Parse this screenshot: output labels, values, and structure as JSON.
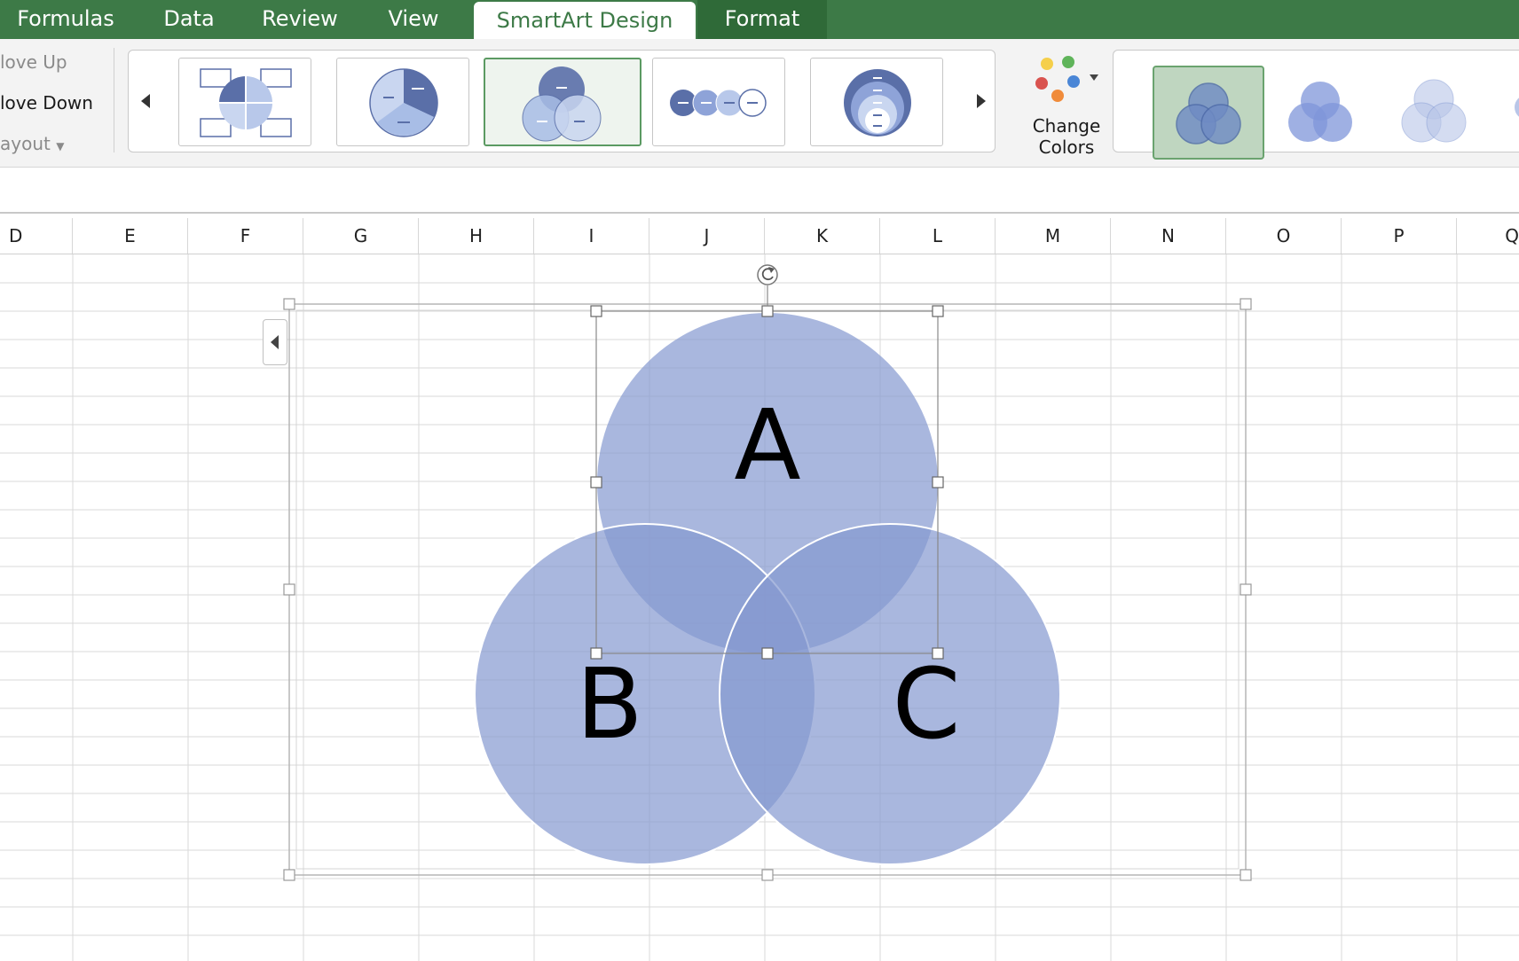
{
  "tabs": [
    {
      "label": "Formulas"
    },
    {
      "label": "Data"
    },
    {
      "label": "Review"
    },
    {
      "label": "View"
    },
    {
      "label": "SmartArt Design",
      "active": true
    },
    {
      "label": "Format"
    }
  ],
  "ribbon": {
    "move_up": "love Up",
    "move_down": "love Down",
    "layout": "ayout",
    "change_colors_line1": "Change",
    "change_colors_line2": "Colors"
  },
  "columns": [
    "D",
    "E",
    "F",
    "G",
    "H",
    "I",
    "J",
    "K",
    "L",
    "M",
    "N",
    "O",
    "P",
    "Q"
  ],
  "smartart": {
    "labels": {
      "a": "A",
      "b": "B",
      "c": "C"
    },
    "fill_color": "#8599d0",
    "accent": "#3d7a47"
  }
}
